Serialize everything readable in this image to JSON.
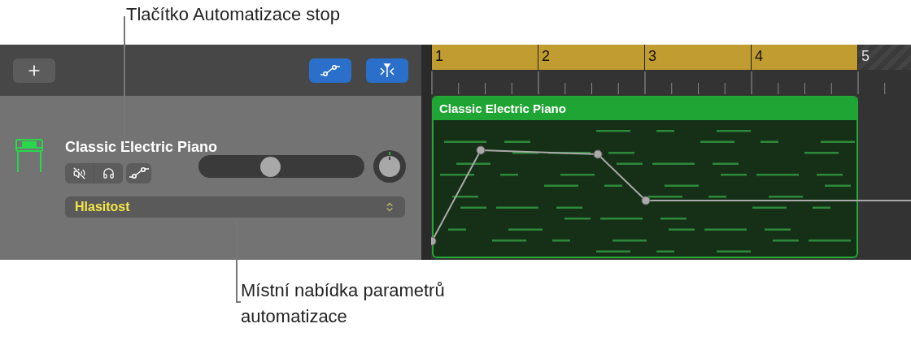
{
  "callouts": [
    {
      "text": "Tlačítko Automatizace stop"
    },
    {
      "text": "Místní nabídka parametrů automatizace"
    }
  ],
  "header": {
    "automation_button": {
      "on": true
    },
    "catch_button": {
      "on": true
    }
  },
  "track": {
    "name": "Classic Electric Piano",
    "mute": {
      "on": false
    },
    "solo": {
      "on": false
    },
    "automation": {
      "on": false
    },
    "volume": {
      "level": 0.43
    },
    "parameter_menu": {
      "value": "Hlasitost"
    }
  },
  "ruler": {
    "bars": [
      {
        "label": "1",
        "in_cycle": true
      },
      {
        "label": "2",
        "in_cycle": true
      },
      {
        "label": "3",
        "in_cycle": true
      },
      {
        "label": "4",
        "in_cycle": true
      },
      {
        "label": "5",
        "in_cycle": false
      }
    ]
  },
  "region": {
    "title": "Classic Electric Piano"
  }
}
